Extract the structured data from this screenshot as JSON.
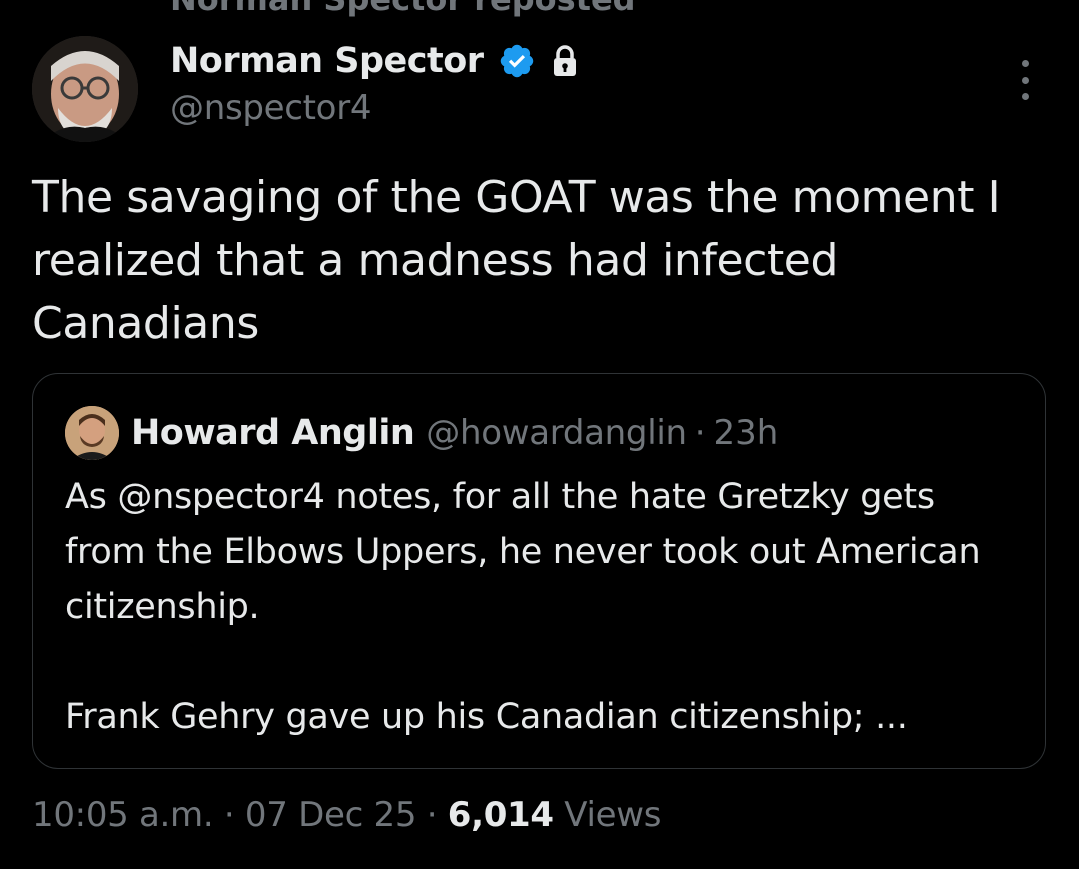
{
  "repost_banner": "Norman Spector reposted",
  "author": {
    "display_name": "Norman Spector",
    "handle": "@nspector4"
  },
  "tweet": {
    "text": "The savaging of the GOAT was the moment I realized that a madness had infected Canadians"
  },
  "quoted_tweet": {
    "display_name": "Howard Anglin",
    "handle": "@howardanglin",
    "separator": "·",
    "time": "23h",
    "body_line_1": "As @nspector4 notes, for all the hate Gretzky gets from the Elbows Uppers, he never took out American citizenship.",
    "body_line_2": "Frank Gehry gave up his Canadian citizenship; ..."
  },
  "meta": {
    "time": "10:05 a.m.",
    "separator": "·",
    "date": "07 Dec 25",
    "views_count": "6,014",
    "views_label": "Views"
  },
  "icons": {
    "verified": "verified-badge-icon",
    "lock": "lock-icon",
    "more": "more-options-icon"
  },
  "colors": {
    "background": "#000000",
    "text_primary": "#e7e9ea",
    "text_secondary": "#71767b",
    "verified_blue": "#1d9bf0",
    "border": "#2f3336"
  }
}
